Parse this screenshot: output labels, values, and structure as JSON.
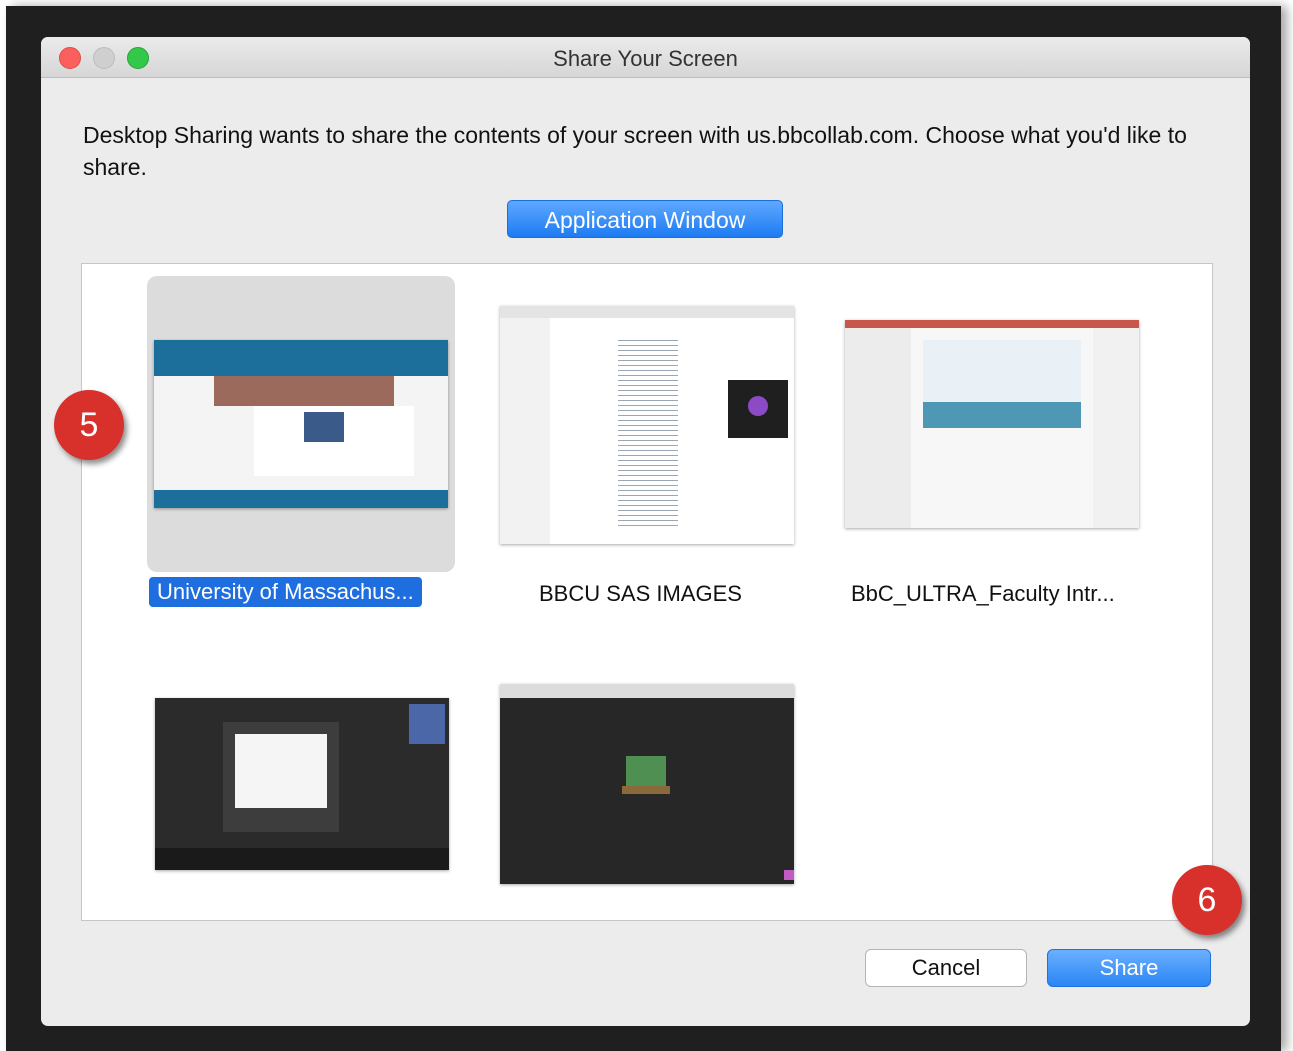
{
  "window": {
    "title": "Share Your Screen"
  },
  "message": "Desktop Sharing wants to share the contents of your screen with us.bbcollab.com. Choose what you'd like to share.",
  "source_tab": "Application Window",
  "windows": [
    {
      "label": "University of Massachus...",
      "selected": true
    },
    {
      "label": "BBCU SAS IMAGES",
      "selected": false
    },
    {
      "label": "BbC_ULTRA_Faculty Intr...",
      "selected": false
    },
    {
      "label": "",
      "selected": false
    },
    {
      "label": "",
      "selected": false
    }
  ],
  "buttons": {
    "cancel": "Cancel",
    "share": "Share"
  },
  "callouts": {
    "step5": "5",
    "step6": "6"
  },
  "colors": {
    "accent": "#1f6ee0",
    "callout": "#d8312c",
    "dark_frame": "#1f1f1f"
  }
}
